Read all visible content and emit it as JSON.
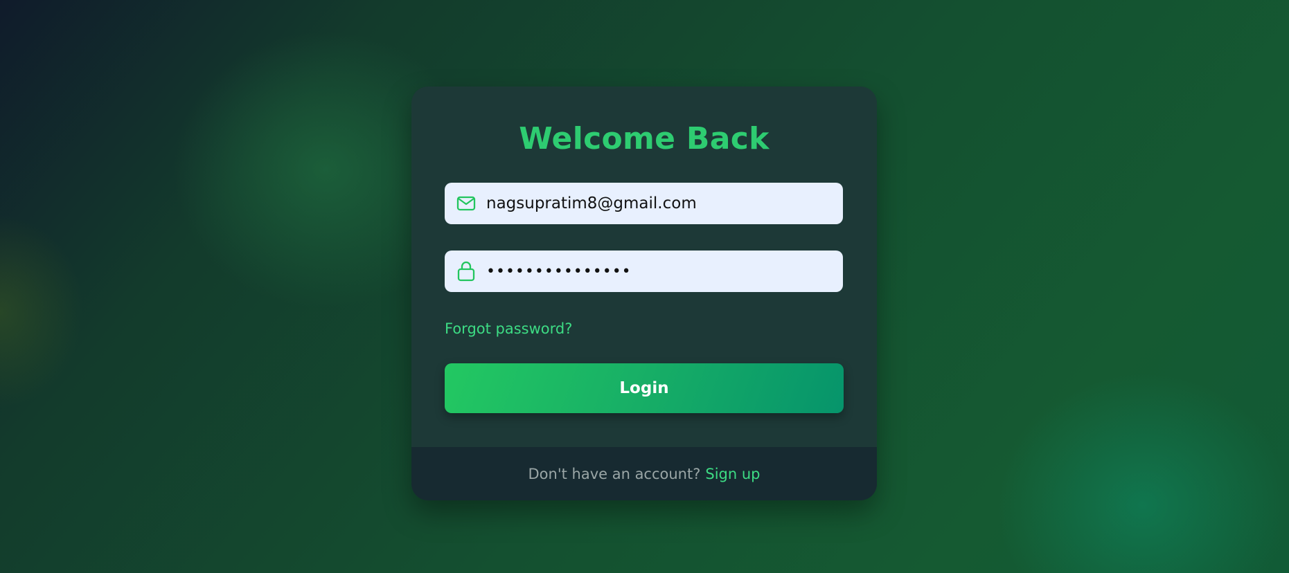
{
  "login": {
    "title": "Welcome Back",
    "email": {
      "icon": "mail-icon",
      "value": "nagsupratim8@gmail.com"
    },
    "password": {
      "icon": "lock-icon",
      "value": "•••••••••••••••"
    },
    "forgot_label": "Forgot password?",
    "submit_label": "Login",
    "footer": {
      "prompt": "Don't have an account?",
      "signup_label": "Sign up"
    }
  },
  "colors": {
    "accent": "#2ecc71",
    "field_bg": "#e8f0fe",
    "card_bg": "#1d3937",
    "footer_bg": "#172a31"
  }
}
